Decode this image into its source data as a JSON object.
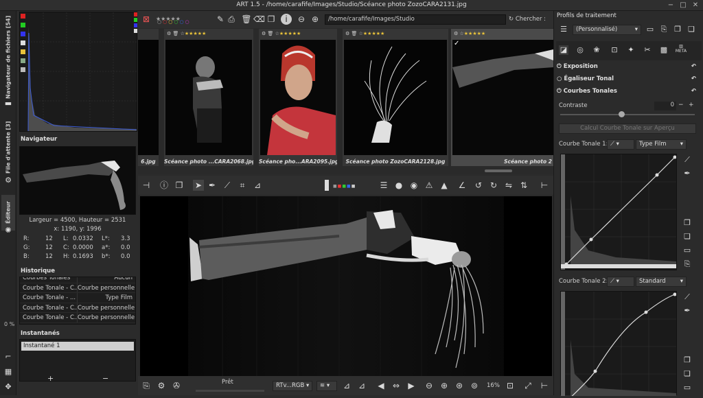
{
  "window": {
    "title": "ART 1.5 - /home/carafife/Images/Studio/Scéance photo ZozoCARA2131.jpg"
  },
  "vtabs": {
    "files": "Navigateur de fichiers [54]",
    "queue": "File d'attente [3]",
    "editor": "Éditeur",
    "percent": "0 %"
  },
  "navigator": {
    "title": "Navigateur",
    "size": "Largeur = 4500, Hauteur = 2531",
    "coords": "x: 1190, y: 1996",
    "r_label": "R:",
    "r_val": "12",
    "l_label": "L:",
    "l_val": "0.0332",
    "ls_label": "L*:",
    "ls_val": "3.3",
    "g_label": "G:",
    "g_val": "12",
    "c_label": "C:",
    "c_val": "0.0000",
    "as_label": "a*:",
    "as_val": "0.0",
    "b_label": "B:",
    "b_val": "12",
    "h_label": "H:",
    "h_val": "0.1693",
    "bs_label": "b*:",
    "bs_val": "0.0"
  },
  "history": {
    "title": "Historique",
    "rows": [
      {
        "a": "Courbes Tonales",
        "b": "Aucun"
      },
      {
        "a": "Courbe Tonale - C...",
        "b": "Courbe personnelle"
      },
      {
        "a": "Courbe Tonale - ...",
        "b": "Type Film"
      },
      {
        "a": "Courbe Tonale - C...",
        "b": "Courbe personnelle"
      },
      {
        "a": "Courbe Tonale - C...",
        "b": "Courbe personnelle"
      }
    ]
  },
  "snapshots": {
    "title": "Instantanés",
    "item": "Instantané 1",
    "add": "+",
    "remove": "−"
  },
  "browser": {
    "path": "/home/carafife/Images/Studio",
    "search": "Chercher :"
  },
  "thumbs": [
    {
      "caption": "6.jpg"
    },
    {
      "caption": "Scéance photo ...CARA2068.jpg"
    },
    {
      "caption": "Scéance pho...ARA2095.jpg"
    },
    {
      "caption": "Scéance photo ZozoCARA2128.jpg"
    },
    {
      "caption": "Scéance photo 2"
    }
  ],
  "bottom": {
    "status": "Prêt",
    "profile": "RTv...RGB",
    "zoom": "16%"
  },
  "right": {
    "title": "Profils de traitement",
    "profile": "(Personnalisé)",
    "exposure": "Exposition",
    "tonal_eq": "Égaliseur Tonal",
    "curves": "Courbes Tonales",
    "contrast_label": "Contraste",
    "contrast_val": "0",
    "calc_btn": "Calcul Courbe Tonale sur Aperçu",
    "curve1_label": "Courbe Tonale 1:",
    "curve1_type": "Type Film",
    "curve2_label": "Courbe Tonale 2:",
    "curve2_type": "Standard",
    "meta": "META"
  },
  "colors": {
    "accent": "#e8c23a",
    "panel": "#2b2b2b",
    "dark": "#1a1a1a"
  }
}
